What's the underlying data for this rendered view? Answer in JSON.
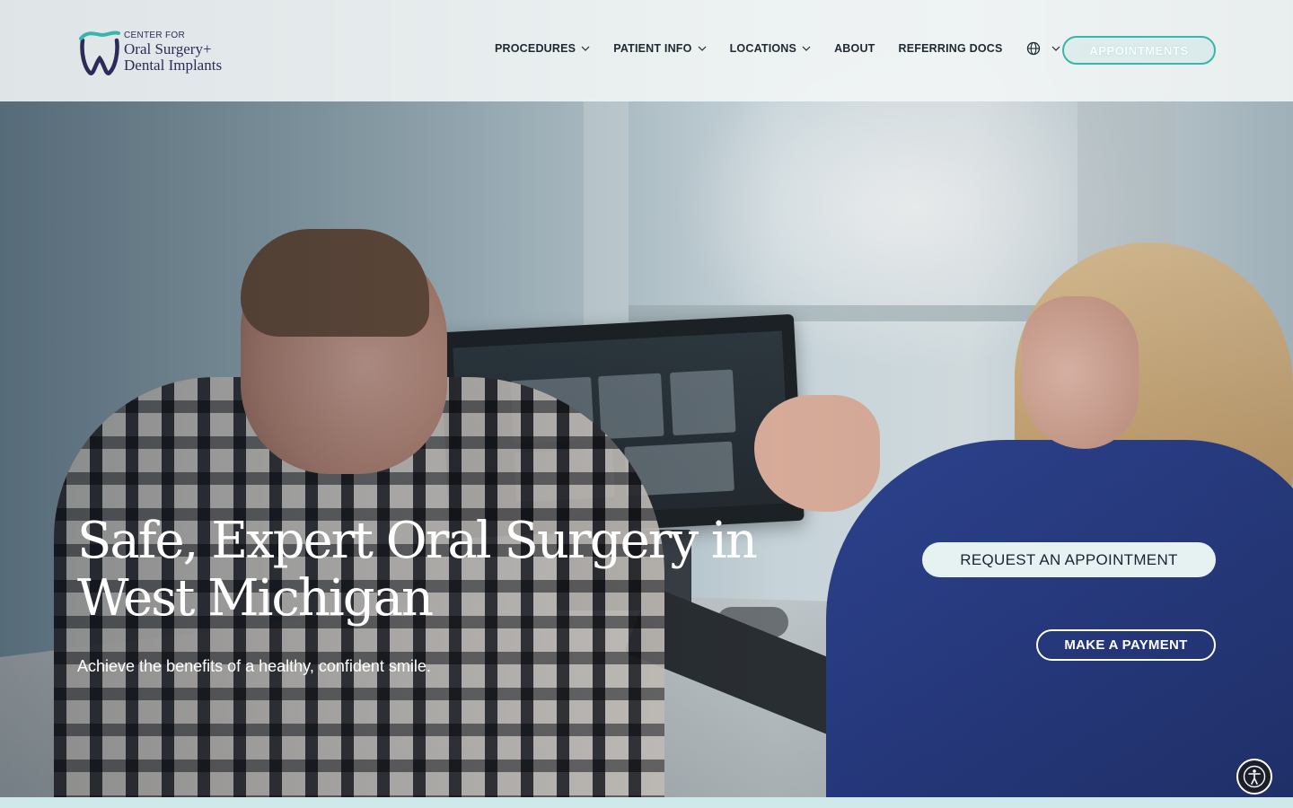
{
  "brand": {
    "logo_line1": "CENTER FOR",
    "logo_line2": "Oral Surgery+",
    "logo_line3": "Dental Implants",
    "colors": {
      "teal": "#36b6ac",
      "navy": "#2d2a5a"
    }
  },
  "nav": {
    "items": [
      {
        "label": "PROCEDURES",
        "has_dropdown": true
      },
      {
        "label": "PATIENT INFO",
        "has_dropdown": true
      },
      {
        "label": "LOCATIONS",
        "has_dropdown": true
      },
      {
        "label": "ABOUT",
        "has_dropdown": false
      },
      {
        "label": "REFERRING DOCS",
        "has_dropdown": false
      }
    ],
    "language_icon": "globe-icon",
    "appointments_label": "APPOINTMENTS"
  },
  "hero": {
    "headline": "Safe, Expert Oral Surgery in West Michigan",
    "subheadline": "Achieve the benefits of a healthy, confident smile.",
    "request_label": "REQUEST AN APPOINTMENT",
    "payment_label": "MAKE A PAYMENT"
  },
  "accessibility": {
    "icon": "accessibility-icon"
  }
}
